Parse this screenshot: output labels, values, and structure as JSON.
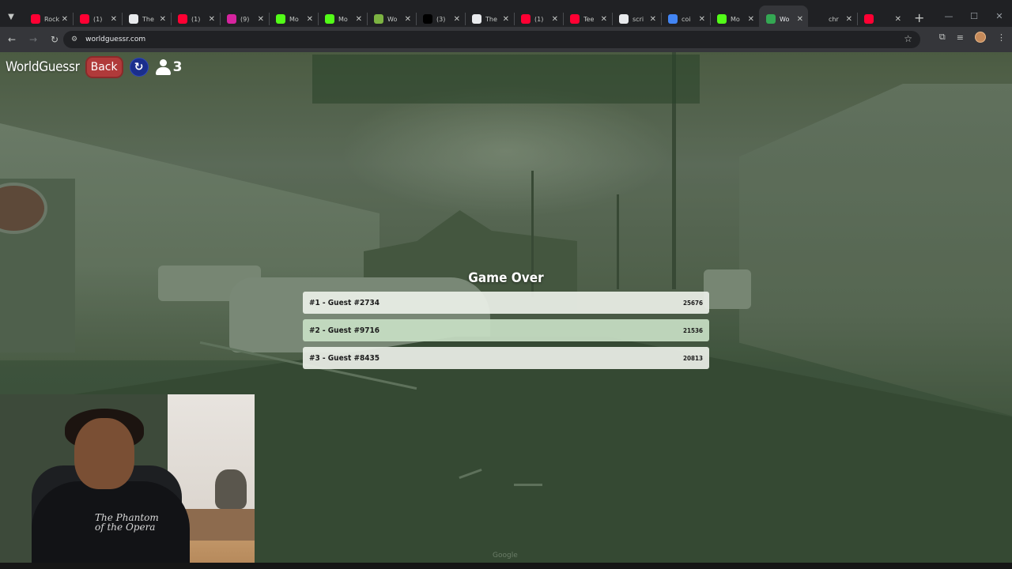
{
  "browser": {
    "tabs": [
      {
        "title": "Rock",
        "favicon": "youtube-icon",
        "color": "#ff0033",
        "active": false
      },
      {
        "title": "(1)",
        "favicon": "youtube-icon",
        "color": "#ff0033",
        "active": false
      },
      {
        "title": "The",
        "favicon": "github-icon",
        "color": "#e8eaed",
        "active": false
      },
      {
        "title": "(1)",
        "favicon": "youtube-icon",
        "color": "#ff0033",
        "active": false
      },
      {
        "title": "(9)",
        "favicon": "instagram-icon",
        "color": "#d6249f",
        "active": false
      },
      {
        "title": "Mo",
        "favicon": "k-icon",
        "color": "#53fc18",
        "active": false
      },
      {
        "title": "Mo",
        "favicon": "k-icon",
        "color": "#53fc18",
        "active": false
      },
      {
        "title": "Wo",
        "favicon": "w-icon",
        "color": "#7cb342",
        "active": false
      },
      {
        "title": "(3)",
        "favicon": "x-icon",
        "color": "#000000",
        "active": false
      },
      {
        "title": "The",
        "favicon": "github-icon",
        "color": "#e8eaed",
        "active": false
      },
      {
        "title": "(1)",
        "favicon": "youtube-icon",
        "color": "#ff0033",
        "active": false
      },
      {
        "title": "Tee",
        "favicon": "youtube-icon",
        "color": "#ff0033",
        "active": false
      },
      {
        "title": "scri",
        "favicon": "blank-page-icon",
        "color": "#e8eaed",
        "active": false
      },
      {
        "title": "coi",
        "favicon": "google-icon",
        "color": "#4285f4",
        "active": false
      },
      {
        "title": "Mo",
        "favicon": "k-icon",
        "color": "#53fc18",
        "active": false
      },
      {
        "title": "Wo",
        "favicon": "globe-icon",
        "color": "#34a853",
        "active": true
      },
      {
        "title": "chr",
        "favicon": "none",
        "color": "#202124",
        "active": false
      },
      {
        "title": "",
        "favicon": "youtube-icon",
        "color": "#ff0033",
        "active": false
      }
    ],
    "url": "worldguessr.com"
  },
  "game": {
    "brand": "WorldGuessr",
    "back_label": "Back",
    "player_count": "3",
    "gameover_title": "Game Over",
    "leaderboard": [
      {
        "rank_name": "#1 - Guest #2734",
        "score": "25676"
      },
      {
        "rank_name": "#2 - Guest #9716",
        "score": "21536"
      },
      {
        "rank_name": "#3 - Guest #8435",
        "score": "20813"
      }
    ],
    "map_attribution": "Google"
  },
  "webcam": {
    "shirt_text": "The Phantom of the Opera"
  }
}
